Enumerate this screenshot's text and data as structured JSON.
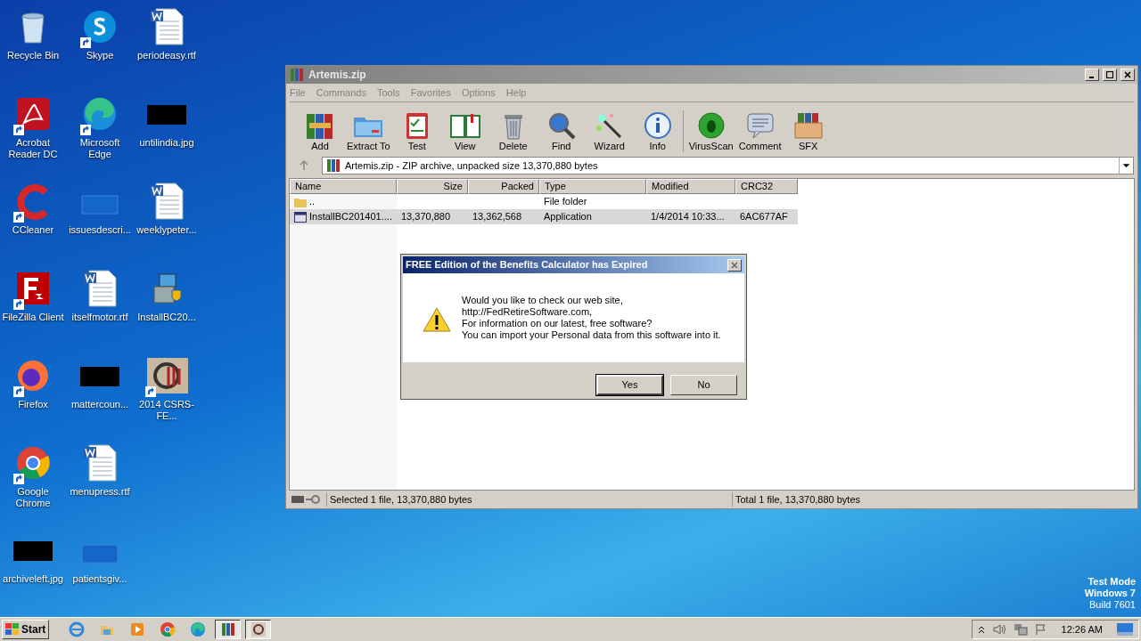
{
  "desktop": {
    "icons": [
      {
        "label": "Recycle Bin",
        "kind": "recycle",
        "shortcut": false
      },
      {
        "label": "Acrobat Reader DC",
        "kind": "acrobat",
        "shortcut": true
      },
      {
        "label": "CCleaner",
        "kind": "ccleaner",
        "shortcut": true
      },
      {
        "label": "FileZilla Client",
        "kind": "filezilla",
        "shortcut": true
      },
      {
        "label": "Firefox",
        "kind": "firefox",
        "shortcut": true
      },
      {
        "label": "Google Chrome",
        "kind": "chrome",
        "shortcut": true
      },
      {
        "label": "archiveleft.jpg",
        "kind": "redacted",
        "shortcut": false
      },
      {
        "label": "Skype",
        "kind": "skype",
        "shortcut": true
      },
      {
        "label": "Microsoft Edge",
        "kind": "edge",
        "shortcut": true
      },
      {
        "label": "issuesdescri...",
        "kind": "blank",
        "shortcut": false
      },
      {
        "label": "itselfmotor.rtf",
        "kind": "word",
        "shortcut": false
      },
      {
        "label": "mattercoun...",
        "kind": "redacted",
        "shortcut": false
      },
      {
        "label": "menupress.rtf",
        "kind": "word",
        "shortcut": false
      },
      {
        "label": "patientsgiv...",
        "kind": "blank",
        "shortcut": false
      },
      {
        "label": "periodeasy.rtf",
        "kind": "word",
        "shortcut": false
      },
      {
        "label": "untilindia.jpg",
        "kind": "redacted",
        "shortcut": false
      },
      {
        "label": "weeklypeter...",
        "kind": "word",
        "shortcut": false
      },
      {
        "label": "InstallBC20...",
        "kind": "installer",
        "shortcut": false
      },
      {
        "label": "2014 CSRS-FE...",
        "kind": "photo",
        "shortcut": true
      }
    ],
    "os_info": [
      "Test Mode",
      "Windows 7",
      "Build 7601"
    ]
  },
  "window": {
    "title": "Artemis.zip",
    "menu": [
      "File",
      "Commands",
      "Tools",
      "Favorites",
      "Options",
      "Help"
    ],
    "toolbar": [
      [
        {
          "label": "Add",
          "kind": "add"
        },
        {
          "label": "Extract To",
          "kind": "extract"
        },
        {
          "label": "Test",
          "kind": "test"
        },
        {
          "label": "View",
          "kind": "view"
        },
        {
          "label": "Delete",
          "kind": "delete"
        },
        {
          "label": "Find",
          "kind": "find"
        },
        {
          "label": "Wizard",
          "kind": "wizard"
        },
        {
          "label": "Info",
          "kind": "info"
        }
      ],
      [
        {
          "label": "VirusScan",
          "kind": "virus"
        },
        {
          "label": "Comment",
          "kind": "comment"
        },
        {
          "label": "SFX",
          "kind": "sfx"
        }
      ]
    ],
    "path": "Artemis.zip - ZIP archive, unpacked size 13,370,880 bytes",
    "table": {
      "columns": [
        "Name",
        "Size",
        "Packed",
        "Type",
        "Modified",
        "CRC32"
      ],
      "rows": [
        {
          "kind": "folder",
          "selected": false,
          "cells": [
            "..",
            "",
            "",
            "File folder",
            "",
            ""
          ]
        },
        {
          "kind": "app",
          "selected": true,
          "cells": [
            "InstallBC201401....",
            "13,370,880",
            "13,362,568",
            "Application",
            "1/4/2014 10:33...",
            "6AC677AF"
          ]
        }
      ]
    },
    "status_bar": [
      "Selected 1 file, 13,370,880 bytes",
      "Total 1 file, 13,370,880 bytes"
    ]
  },
  "dialog": {
    "title": "FREE Edition of the Benefits Calculator has Expired",
    "message": [
      "Would you like to check our web site,",
      "http://FedRetireSoftware.com,",
      "For information on our latest, free software?",
      "You can import your Personal data from this software into it."
    ],
    "buttons": [
      {
        "label": "Yes",
        "selected": true
      },
      {
        "label": "No",
        "selected": false
      }
    ]
  },
  "taskbar": {
    "start": "Start",
    "apps": [
      {
        "kind": "ie",
        "selected": false
      },
      {
        "kind": "explorer",
        "selected": false
      },
      {
        "kind": "media",
        "selected": false
      },
      {
        "kind": "chrome",
        "selected": false
      },
      {
        "kind": "edge",
        "selected": false
      },
      {
        "kind": "winrar",
        "selected": true
      },
      {
        "kind": "dialog",
        "selected": true
      }
    ],
    "time": "12:26 AM"
  }
}
